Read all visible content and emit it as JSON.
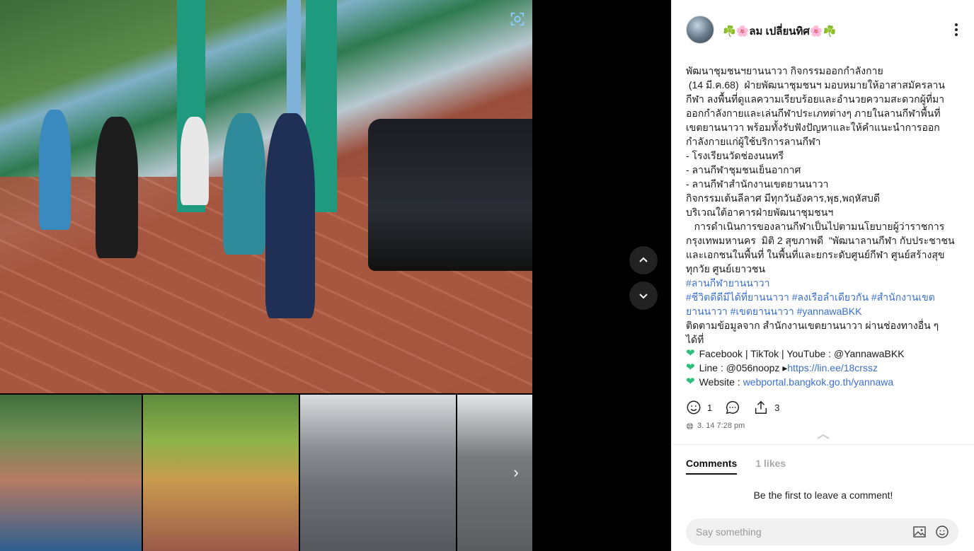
{
  "post": {
    "author": "☘️🌸ลม เปลี่ยนทิศ🌸☘️",
    "body": [
      "พัฒนาชุมชนฯยานนาวา กิจกรรมออกกำลังกาย",
      " (14 มี.ค.68)  ฝ่ายพัฒนาชุมชนฯ มอบหมายให้อาสาสมัครลานกีฬา ลงพื้นที่ดูแลความเรียบร้อยและอำนวยความสะดวกผู้ที่มาออกกำลังกายและเล่นกีฬาประเภทต่างๆ ภายในลานกีฬาพื้นที่เขตยานนาวา พร้อมทั้งรับฟังปัญหาและให้คำแนะนำการออกกำลังกายแก่ผู้ใช้บริการลานกีฬา",
      "- โรงเรียนวัดช่องนนทรี",
      "- ลานกีฬาชุมชนเย็นอากาศ",
      "- ลานกีฬาสำนักงานเขตยานนาวา",
      "กิจกรรมเต้นลีลาศ มีทุกวันอังคาร,พุธ,พฤหัสบดี",
      "บริเวณใต้อาคารฝ่ายพัฒนาชุมชนฯ",
      "   การดำเนินการของลานกีฬาเป็นไปตามนโยบายผู้ว่าราชการกรุงเทพมหานคร  มิติ 2 สุขภาพดี  \"พัฒนาลานกีฬา กับประชาชนและเอกชนในพื้นที่ ในพื้นที่และยกระดับศูนย์กีฬา ศูนย์สร้างสุขทุกวัย ศูนย์เยาวชน"
    ],
    "hashtags_line1": "#ลานกีฬายานนาวา",
    "hashtags_line2": "#ชีวิตดีดีมีได้ที่ยานนาวา #ลงเรือลำเดียวกัน #สำนักงานเขตยานนาวา #เขตยานนาวา #yannawaBKK",
    "follow_text": "ติดตามข้อมูลจาก สำนักงานเขตยานนาวา ผ่านช่องทางอื่น ๆ ได้ที่",
    "contacts": {
      "social": "Facebook | TikTok | YouTube : @YannawaBKK",
      "line_prefix": "Line : @056noopz ▸ ",
      "line_url": "https://lin.ee/18crssz",
      "web_prefix": "Website : ",
      "web_url": "webportal.bangkok.go.th/yannawa"
    },
    "reactions_count": "1",
    "shares_count": "3",
    "timestamp": "3. 14 7:28 pm"
  },
  "tabs": {
    "comments": "Comments",
    "likes": "1 likes"
  },
  "empty_comments": "Be the first to leave a comment!",
  "composer": {
    "placeholder": "Say something"
  },
  "icons": {
    "focus": "focus-frame-icon",
    "prev": "chevron-up-icon",
    "next": "chevron-down-icon",
    "emoji": "smiley-icon",
    "comment": "comment-bubble-icon",
    "share": "share-icon",
    "globe": "globe-icon",
    "image": "image-icon",
    "more": "more-vertical-icon"
  },
  "colors": {
    "hashtag": "#3b6fd1",
    "heart": "#2bbf7a",
    "viewer_bg": "#000000"
  }
}
